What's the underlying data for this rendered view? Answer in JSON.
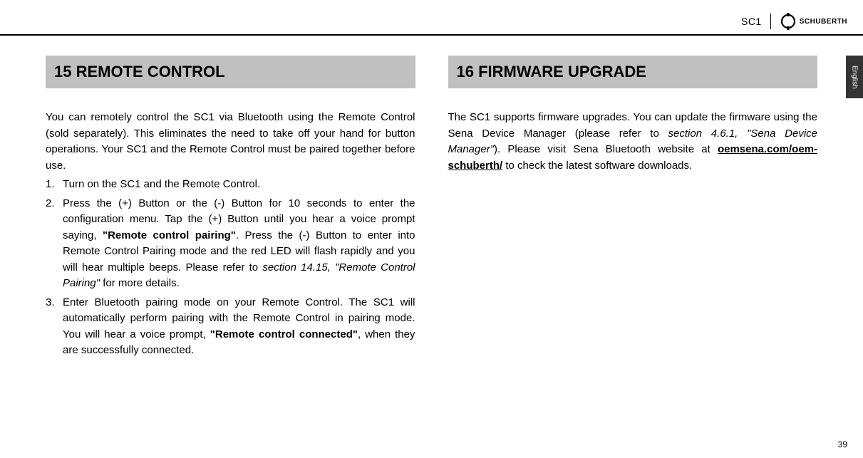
{
  "header": {
    "product": "SC1",
    "brand": "SCHUBERTH"
  },
  "language_tab": "English",
  "left": {
    "heading": "15 REMOTE CONTROL",
    "intro": "You can remotely control the SC1 via Bluetooth using the Remote Control (sold separately). This eliminates the need to take off your hand for button operations. Your SC1 and the Remote Control must be paired together before use.",
    "steps": {
      "s1": {
        "num": "1.",
        "text": "Turn on the SC1 and the Remote Control."
      },
      "s2": {
        "num": "2.",
        "pre": "Press the (+) Button or the (-) Button for 10 seconds to enter the configuration menu. Tap the (+) Button until you hear a voice prompt saying, ",
        "bold1": "\"Remote control pairing\"",
        "mid": ". Press the (-) Button to enter into Remote Control Pairing mode and the red LED will flash rapidly and you will hear multiple beeps. Please refer to ",
        "ref": "section 14.15, \"Remote Control Pairing\"",
        "post": " for more details."
      },
      "s3": {
        "num": "3.",
        "pre": "Enter Bluetooth pairing mode on your Remote Control. The SC1 will automatically perform pairing with the Remote Control in pairing mode. You will hear a voice prompt, ",
        "bold1": "\"Remote control connected\"",
        "post": ", when they are successfully connected."
      }
    }
  },
  "right": {
    "heading": "16 FIRMWARE UPGRADE",
    "para": {
      "pre": "The SC1 supports firmware upgrades. You can update the firmware using the Sena Device Manager (please refer to ",
      "ref": "section 4.6.1, \"Sena Device Manager\"",
      "mid": "). Please visit Sena Bluetooth website at ",
      "link": "oemsena.com/oem-schuberth/",
      "post": " to check the latest software downloads."
    }
  },
  "page_number": "39"
}
